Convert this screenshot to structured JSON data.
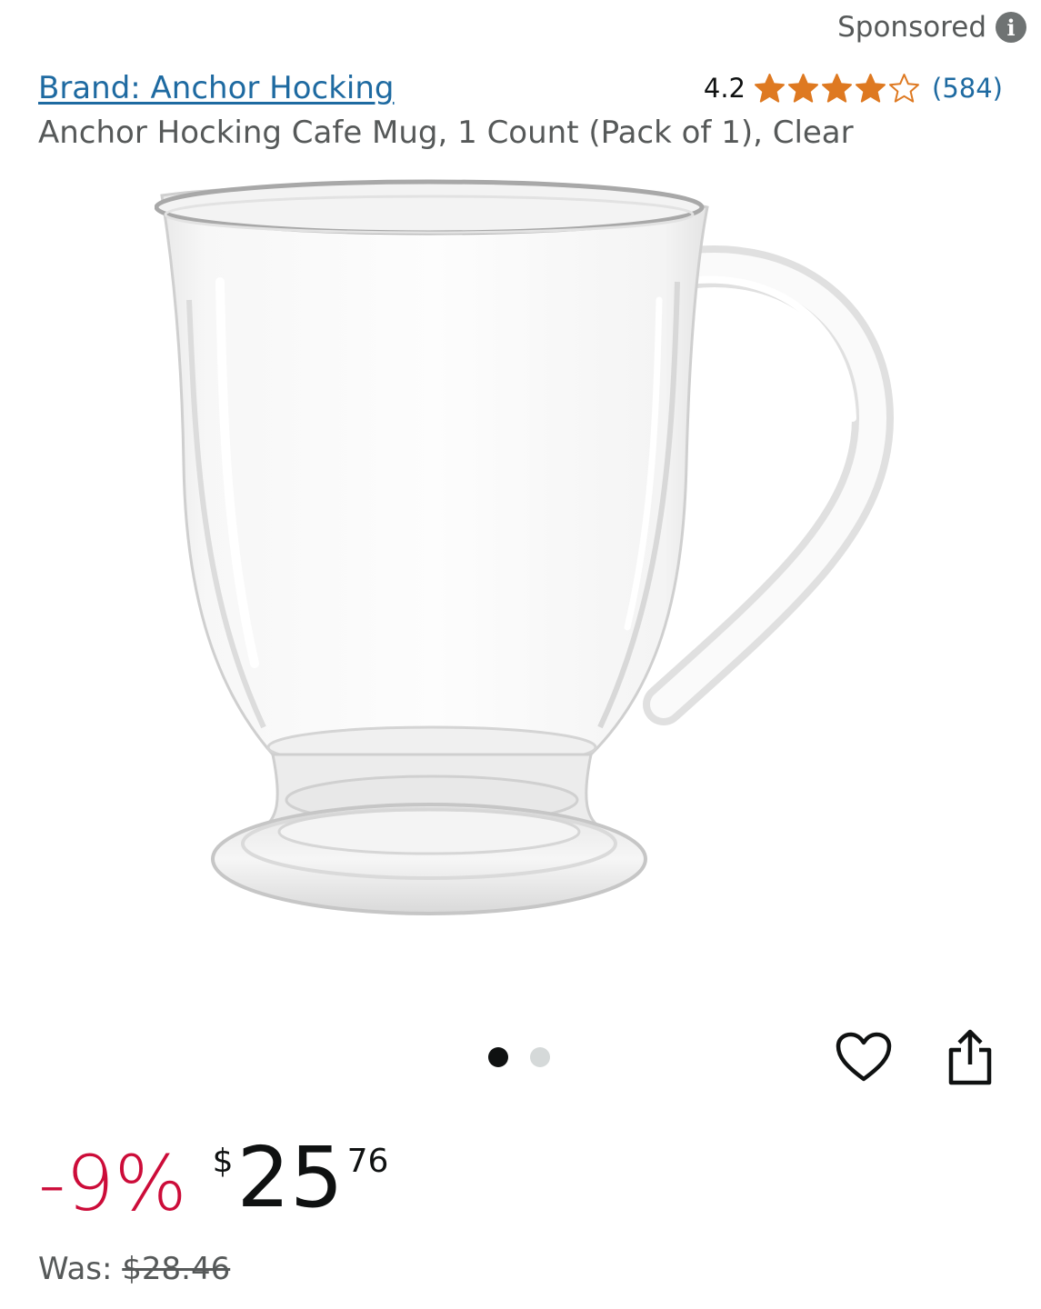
{
  "sponsored": {
    "label": "Sponsored",
    "icon": "info-icon",
    "icon_glyph": "i"
  },
  "product": {
    "brand_link": "Brand: Anchor Hocking",
    "title": "Anchor Hocking Cafe Mug, 1 Count (Pack of 1), Clear",
    "rating": {
      "value": "4.2",
      "stars": 4.2,
      "max_stars": 5,
      "count": "(584)",
      "star_color": "#de7921"
    },
    "image": {
      "description_icon": "glass-mug-image",
      "carousel_total": 2,
      "carousel_active": 1
    },
    "actions": {
      "wishlist_icon": "heart-icon",
      "share_icon": "share-icon"
    },
    "price": {
      "discount": "-9%",
      "currency": "$",
      "whole": "25",
      "fraction": "76",
      "was_label": "Was:",
      "was_price": "$28.46"
    }
  },
  "colors": {
    "link": "#1e6aa1",
    "discount": "#cc0c39",
    "secondary_text": "#565959"
  }
}
